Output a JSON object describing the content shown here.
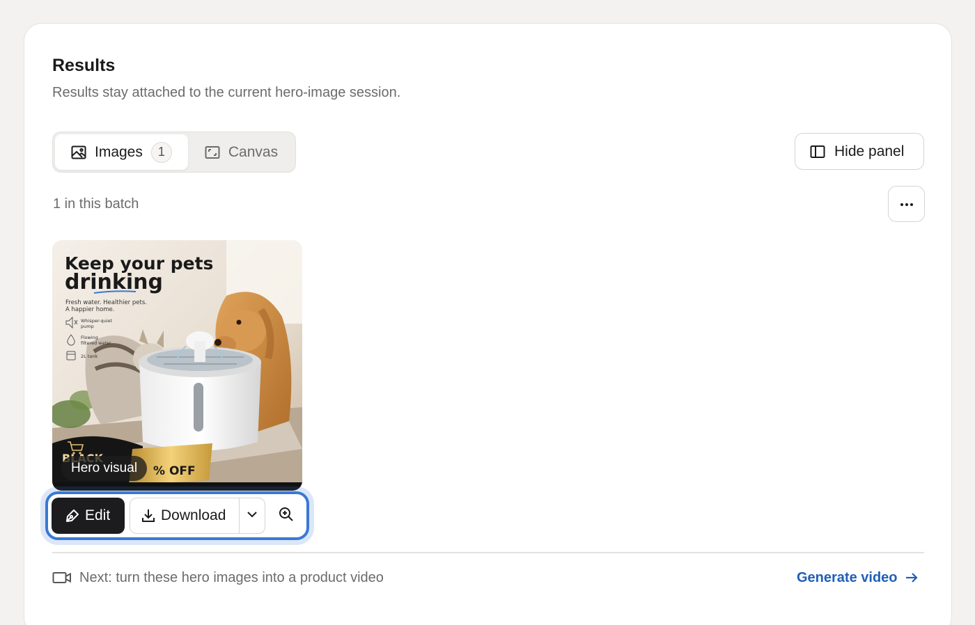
{
  "results": {
    "title": "Results",
    "subtitle": "Results stay attached to the current hero-image session."
  },
  "tabs": [
    {
      "label": "Images",
      "count": "1",
      "active": true,
      "icon": "image-icon"
    },
    {
      "label": "Canvas",
      "active": false,
      "icon": "canvas-icon"
    }
  ],
  "hide_panel": {
    "label": "Hide panel",
    "icon": "panel-icon"
  },
  "batch": {
    "text": "1 in this batch"
  },
  "more_button": {
    "icon": "more-horizontal-icon"
  },
  "thumbnail": {
    "label": "Hero visual",
    "headline_line1": "Keep your pets",
    "headline_line2": "drinking",
    "tagline_line1": "Fresh water. Healthier pets.",
    "tagline_line2": "A happier home.",
    "features": [
      {
        "text1": "Whisper-quiet",
        "text2": "pump",
        "icon": "mute-speaker-icon"
      },
      {
        "text1": "Flowing",
        "text2": "filtered water",
        "icon": "water-drop-icon"
      },
      {
        "text1": "2L tank",
        "text2": "",
        "icon": "tank-icon"
      }
    ],
    "badge_word": "BLACK",
    "badge_off": "% OFF",
    "badge_icon": "cart-icon"
  },
  "actions": {
    "edit_label": "Edit",
    "download_label": "Download",
    "edit_icon": "pen-icon",
    "download_icon": "download-icon",
    "caret_icon": "chevron-down-icon",
    "zoom_icon": "zoom-in-icon"
  },
  "next": {
    "text": "Next: turn these hero images into a product video",
    "icon": "video-camera-icon",
    "cta": "Generate video",
    "cta_icon": "arrow-right-icon"
  },
  "colors": {
    "accent_blue": "#1f5fb8",
    "focus_ring": "#3a78d6",
    "edit_button_bg": "#1c1c1e",
    "page_bg": "#f3f2f0"
  }
}
